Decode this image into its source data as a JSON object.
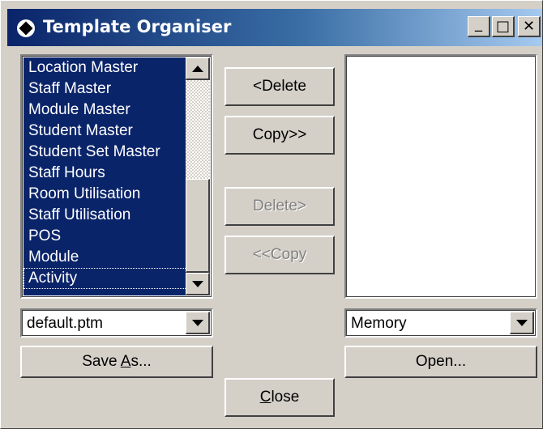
{
  "window": {
    "title": "Template Organiser",
    "minimize_label": "_",
    "maximize_label": "□",
    "close_label": "✕"
  },
  "left_list": {
    "items": [
      "Location Master",
      "Staff Master",
      "Module Master",
      "Student Master",
      "Student Set Master",
      "Staff Hours",
      "Room Utilisation",
      "Staff Utilisation",
      "POS",
      "Module",
      "Activity"
    ],
    "selected_all": true
  },
  "buttons": {
    "delete_left": "<Delete",
    "copy_right": "Copy>>",
    "delete_right": "Delete>",
    "copy_left": "<<Copy",
    "save_as_pre": "Save ",
    "save_as_accel": "A",
    "save_as_post": "s...",
    "open": "Open...",
    "close_accel": "C",
    "close_post": "lose"
  },
  "left_combo": {
    "value": "default.ptm"
  },
  "right_combo": {
    "value": "Memory"
  },
  "colors": {
    "selection": "#0a246a",
    "face": "#d4d0c8",
    "title_start": "#0a246a"
  }
}
